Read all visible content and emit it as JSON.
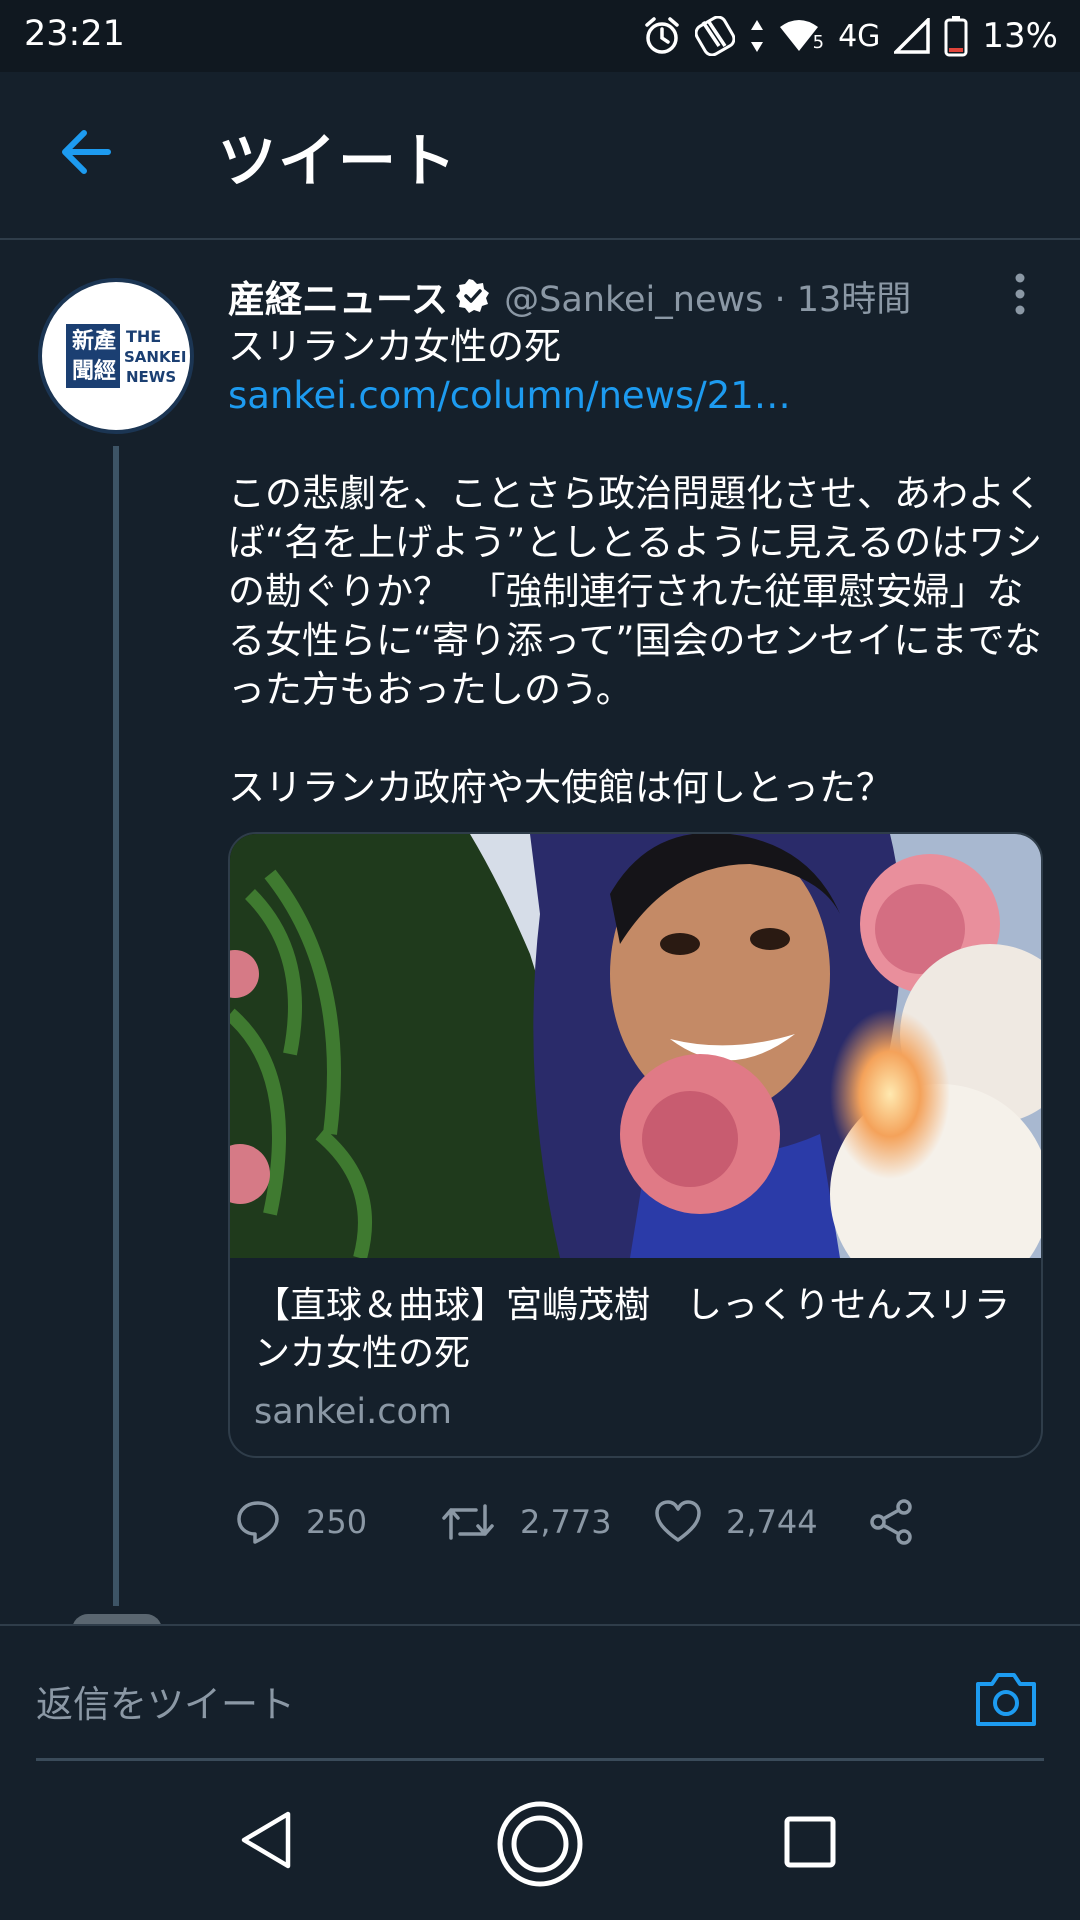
{
  "status_bar": {
    "time": "23:21",
    "network_type": "4G",
    "wifi_level": "5",
    "battery_percent": "13%",
    "icons": [
      "alarm-icon",
      "nfc-icon",
      "data-arrows-icon",
      "wifi-icon",
      "signal-icon",
      "battery-icon"
    ]
  },
  "app_bar": {
    "title": "ツイート",
    "back_icon": "arrow-left-icon"
  },
  "tweet": {
    "author_name": "産経ニュース",
    "handle_time": "@Sankei_news · 13時間",
    "headline": "スリランカ女性の死",
    "link_text": "sankei.com/column/news/21…",
    "body": "この悲劇を、ことさら政治問題化させ、あわよくば“名を上げよう”としとるように見えるのはワシの勘ぐりか？　「強制連行された従軍慰安婦」なる女性らに“寄り添って”国会のセンセイにまでなった方もおったしのう。",
    "body2": "スリランカ政府や大使館は何しとった？",
    "avatar_logo": {
      "kanji": "産経新聞",
      "text": "THE SANKEI NEWS"
    },
    "card": {
      "title": "【直球＆曲球】宮嶋茂樹　しっくりせんスリランカ女性の死",
      "domain": "sankei.com"
    },
    "actions": {
      "replies": "250",
      "retweets": "2,773",
      "likes": "2,744"
    }
  },
  "reply_bar": {
    "placeholder": "返信をツイート"
  },
  "colors": {
    "background": "#15202b",
    "status_bar": "#101820",
    "accent": "#1d9bf0",
    "secondary_text": "#8b98a5",
    "border": "#2f3d4a"
  }
}
